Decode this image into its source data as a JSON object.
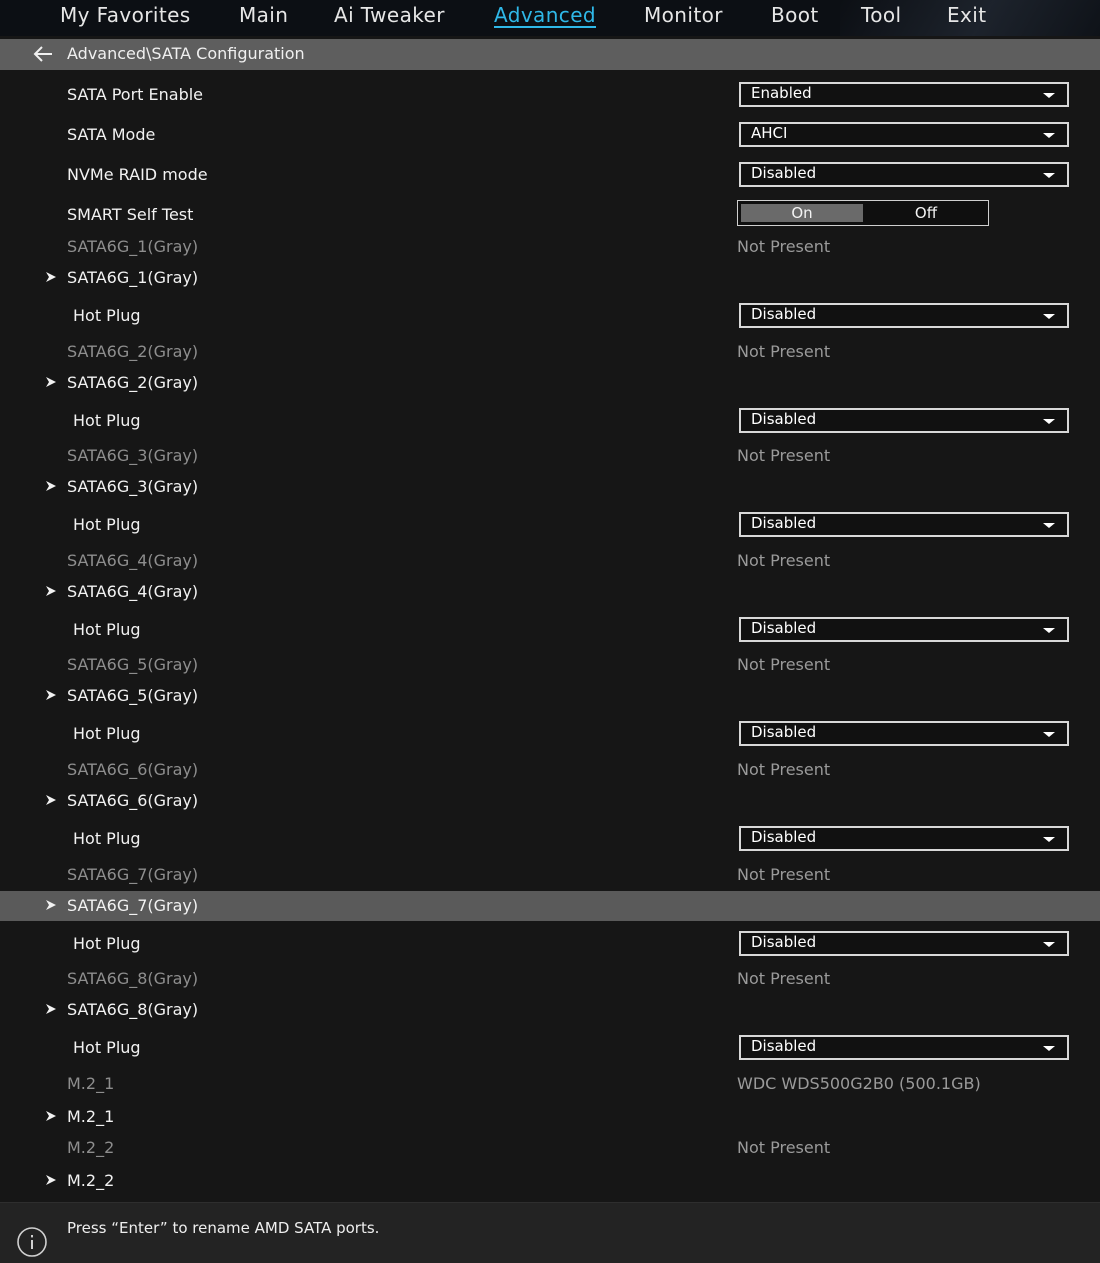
{
  "menu": {
    "items": [
      {
        "label": "My Favorites"
      },
      {
        "label": "Main"
      },
      {
        "label": "Ai Tweaker"
      },
      {
        "label": "Advanced",
        "active": true
      },
      {
        "label": "Monitor"
      },
      {
        "label": "Boot"
      },
      {
        "label": "Tool"
      },
      {
        "label": "Exit"
      }
    ],
    "active_color": "#2fb8e8"
  },
  "breadcrumb": {
    "icon": "back-arrow-icon",
    "path": "Advanced\\SATA Configuration"
  },
  "settings": [
    {
      "label": "SATA Port Enable",
      "value": "Enabled"
    },
    {
      "label": "SATA Mode",
      "value": "AHCI"
    },
    {
      "label": "NVMe RAID mode",
      "value": "Disabled"
    },
    {
      "label": "SMART Self Test",
      "on": "On",
      "off": "Off",
      "selected": "On"
    }
  ],
  "ports": [
    {
      "info_label": "SATA6G_1(Gray)",
      "status": "Not Present",
      "submenu_label": "SATA6G_1(Gray)",
      "hotplug_label": "Hot Plug",
      "hotplug_value": "Disabled"
    },
    {
      "info_label": "SATA6G_2(Gray)",
      "status": "Not Present",
      "submenu_label": "SATA6G_2(Gray)",
      "hotplug_label": "Hot Plug",
      "hotplug_value": "Disabled"
    },
    {
      "info_label": "SATA6G_3(Gray)",
      "status": "Not Present",
      "submenu_label": "SATA6G_3(Gray)",
      "hotplug_label": "Hot Plug",
      "hotplug_value": "Disabled"
    },
    {
      "info_label": "SATA6G_4(Gray)",
      "status": "Not Present",
      "submenu_label": "SATA6G_4(Gray)",
      "hotplug_label": "Hot Plug",
      "hotplug_value": "Disabled"
    },
    {
      "info_label": "SATA6G_5(Gray)",
      "status": "Not Present",
      "submenu_label": "SATA6G_5(Gray)",
      "hotplug_label": "Hot Plug",
      "hotplug_value": "Disabled"
    },
    {
      "info_label": "SATA6G_6(Gray)",
      "status": "Not Present",
      "submenu_label": "SATA6G_6(Gray)",
      "hotplug_label": "Hot Plug",
      "hotplug_value": "Disabled"
    },
    {
      "info_label": "SATA6G_7(Gray)",
      "status": "Not Present",
      "submenu_label": "SATA6G_7(Gray)",
      "selected": true,
      "hotplug_label": "Hot Plug",
      "hotplug_value": "Disabled"
    },
    {
      "info_label": "SATA6G_8(Gray)",
      "status": "Not Present",
      "submenu_label": "SATA6G_8(Gray)",
      "hotplug_label": "Hot Plug",
      "hotplug_value": "Disabled"
    }
  ],
  "m2": [
    {
      "info_label": "M.2_1",
      "status": "WDC WDS500G2B0 (500.1GB)",
      "submenu_label": "M.2_1"
    },
    {
      "info_label": "M.2_2",
      "status": "Not Present",
      "submenu_label": "M.2_2"
    }
  ],
  "footer": {
    "icon": "info-icon",
    "text": "Press “Enter” to rename AMD SATA ports."
  }
}
